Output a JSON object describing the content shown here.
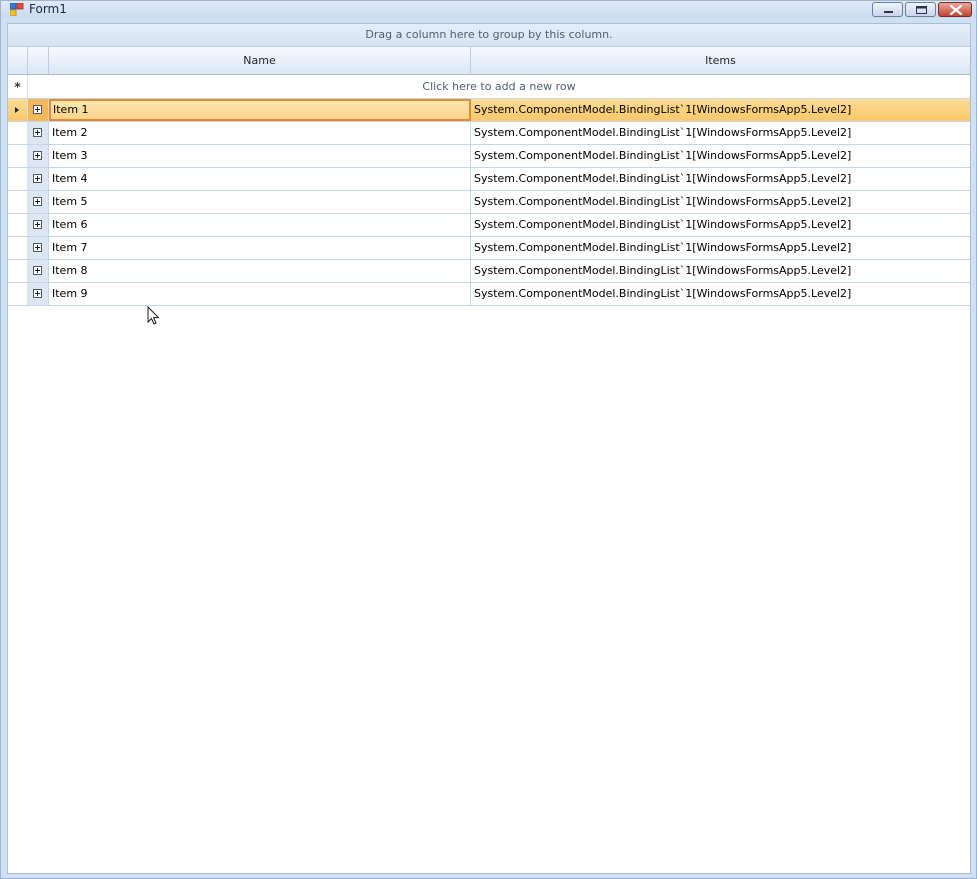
{
  "window": {
    "title": "Form1"
  },
  "grid": {
    "group_panel_text": "Drag a column here to group by this column.",
    "columns": [
      "Name",
      "Items"
    ],
    "new_row_text": "Click here to add a new row",
    "rows": [
      {
        "name": "Item 1",
        "items": "System.ComponentModel.BindingList`1[WindowsFormsApp5.Level2]",
        "selected": true
      },
      {
        "name": "Item 2",
        "items": "System.ComponentModel.BindingList`1[WindowsFormsApp5.Level2]"
      },
      {
        "name": "Item 3",
        "items": "System.ComponentModel.BindingList`1[WindowsFormsApp5.Level2]"
      },
      {
        "name": "Item 4",
        "items": "System.ComponentModel.BindingList`1[WindowsFormsApp5.Level2]"
      },
      {
        "name": "Item 5",
        "items": "System.ComponentModel.BindingList`1[WindowsFormsApp5.Level2]"
      },
      {
        "name": "Item 6",
        "items": "System.ComponentModel.BindingList`1[WindowsFormsApp5.Level2]"
      },
      {
        "name": "Item 7",
        "items": "System.ComponentModel.BindingList`1[WindowsFormsApp5.Level2]"
      },
      {
        "name": "Item 8",
        "items": "System.ComponentModel.BindingList`1[WindowsFormsApp5.Level2]"
      },
      {
        "name": "Item 9",
        "items": "System.ComponentModel.BindingList`1[WindowsFormsApp5.Level2]"
      }
    ]
  },
  "colors": {
    "selection": "#fbc869",
    "focus_border": "#e88a2e",
    "grid_line": "#c5d6e8"
  }
}
